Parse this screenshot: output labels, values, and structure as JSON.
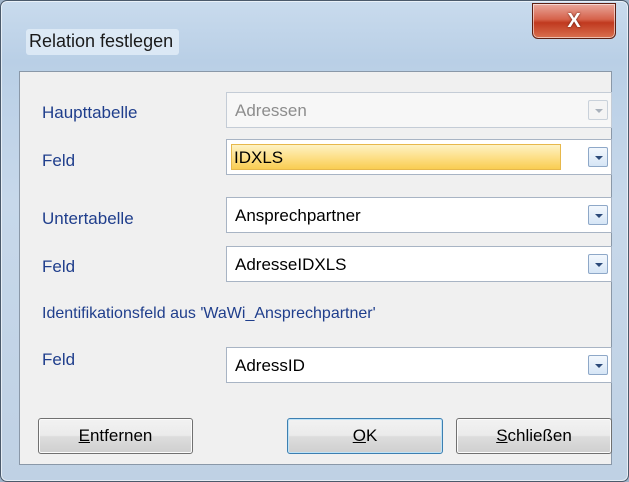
{
  "window": {
    "title": "Relation festlegen",
    "close_glyph": "X"
  },
  "form": {
    "haupttabelle": {
      "label": "Haupttabelle",
      "value": "Adressen",
      "enabled": false
    },
    "feld1": {
      "label": "Feld",
      "value": "IDXLS"
    },
    "untertabelle": {
      "label": "Untertabelle",
      "value": "Ansprechpartner"
    },
    "feld2": {
      "label": "Feld",
      "value": "AdresseIDXLS"
    },
    "ident_caption": "Identifikationsfeld aus 'WaWi_Ansprechpartner'",
    "feld3": {
      "label": "Feld",
      "value": "AdressID"
    }
  },
  "buttons": {
    "remove": {
      "accel": "E",
      "rest": "ntfernen"
    },
    "ok": {
      "accel": "O",
      "rest": "K"
    },
    "close": {
      "accel": "S",
      "rest": "chließen"
    }
  },
  "colors": {
    "label": "#1f3e8c",
    "focus_highlight": "#fde08a",
    "close_button": "#c0391f"
  }
}
